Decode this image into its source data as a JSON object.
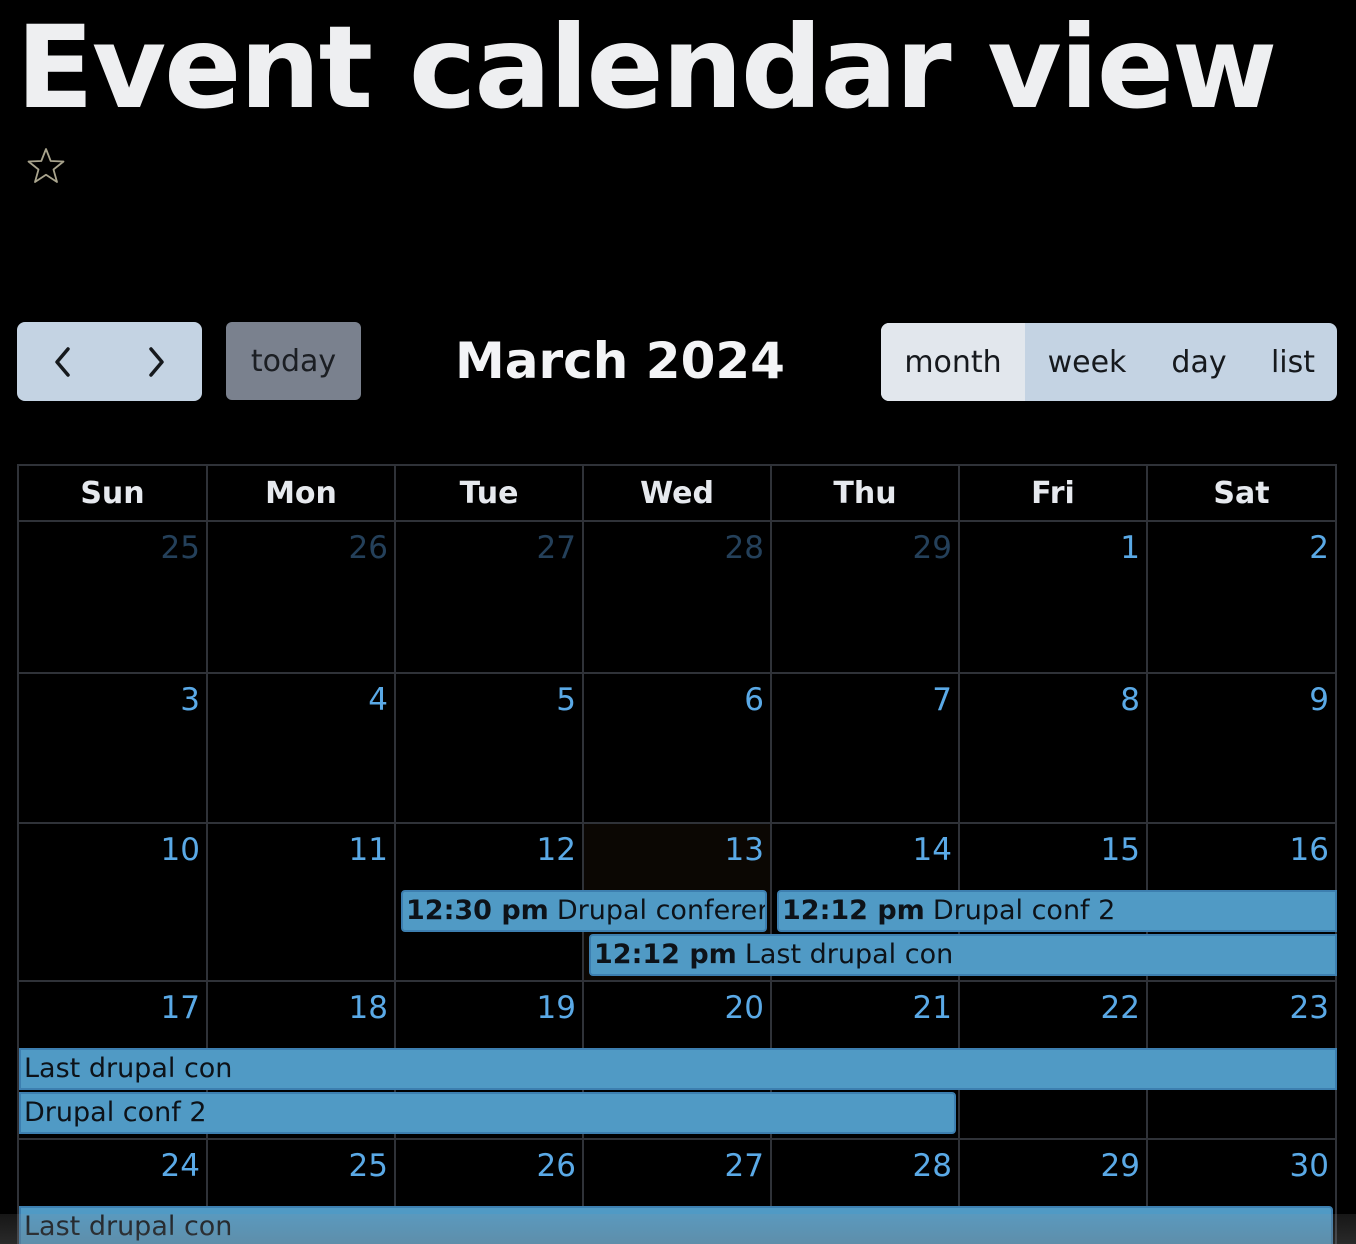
{
  "page": {
    "title": "Event calendar view"
  },
  "toolbar": {
    "today_label": "today",
    "month_title": "March 2024",
    "views": [
      "month",
      "week",
      "day",
      "list"
    ],
    "active_view": "month"
  },
  "calendar": {
    "days_of_week": [
      "Sun",
      "Mon",
      "Tue",
      "Wed",
      "Thu",
      "Fri",
      "Sat"
    ],
    "weeks": [
      [
        "25",
        "26",
        "27",
        "28",
        "29",
        "1",
        "2"
      ],
      [
        "3",
        "4",
        "5",
        "6",
        "7",
        "8",
        "9"
      ],
      [
        "10",
        "11",
        "12",
        "13",
        "14",
        "15",
        "16"
      ],
      [
        "17",
        "18",
        "19",
        "20",
        "21",
        "22",
        "23"
      ],
      [
        "24",
        "25",
        "26",
        "27",
        "28",
        "29",
        "30"
      ]
    ],
    "events": {
      "drupal_conference": {
        "time": "12:30 pm",
        "title": "Drupal conference"
      },
      "drupal_conf_2": {
        "time": "12:12 pm",
        "title": "Drupal conf 2",
        "continued_title": "Drupal conf 2"
      },
      "last_drupal_con": {
        "time": "12:12 pm",
        "title": "Last drupal con",
        "continued_title": "Last drupal con"
      }
    }
  },
  "colors": {
    "event": "#509ac5",
    "daynum": "#5aa9e6",
    "today_bg": "#0b0703"
  }
}
